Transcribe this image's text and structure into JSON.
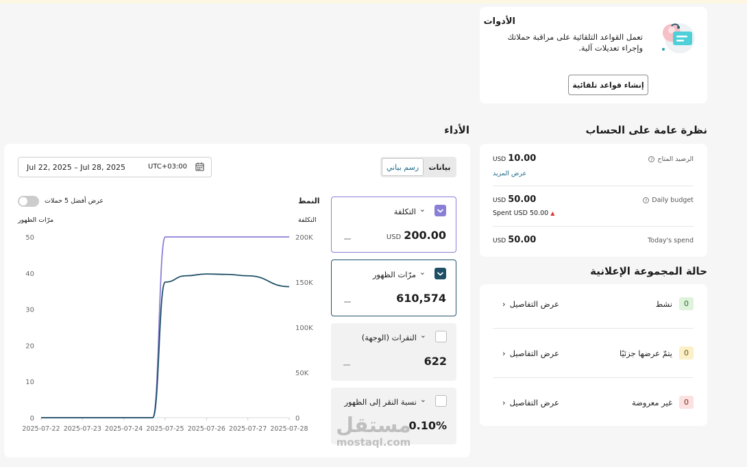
{
  "tools": {
    "title": "الأدوات",
    "description": "تعمل القواعد التلقائية على مراقبة حملاتك وإجراء تعديلات آلية.",
    "button_label": "إنشاء قواعد تلقائية"
  },
  "performance": {
    "title": "الأداء",
    "date_range": "Jul 22, 2025 – Jul 28, 2025",
    "timezone": "UTC+03:00",
    "tabs": {
      "data": "بيانات",
      "chart": "رسم بياني"
    },
    "pattern_label": "النمط",
    "top5_label": "عرض أفضل 5 حملات",
    "left_axis_title": "مرّات الظهور",
    "right_axis_title": "التكلفة",
    "metrics": [
      {
        "label": "التكلفة",
        "currency": "USD",
        "value": "200.00",
        "checked": true,
        "color": "#8a7fd6"
      },
      {
        "label": "مرّات الظهور",
        "value": "610,574",
        "checked": true,
        "color": "#1e4f66"
      },
      {
        "label": "النقرات (الوجهة)",
        "value": "622",
        "checked": false
      },
      {
        "label": "نسبة النقر إلى الظهور",
        "value": "0.10%",
        "checked": false
      }
    ]
  },
  "overview": {
    "title": "نظرة عامة على الحساب",
    "available_balance": {
      "label": "الرصيد المتاح",
      "currency": "USD",
      "value": "10.00",
      "link": "عرض المزيد"
    },
    "daily_budget": {
      "label": "Daily budget",
      "currency": "USD",
      "value": "50.00",
      "spent": "Spent USD 50.00"
    },
    "todays_spend": {
      "label": "Today's spend",
      "currency": "USD",
      "value": "50.00"
    }
  },
  "ad_group_status": {
    "title": "حالة المجموعة الإعلانية",
    "rows": [
      {
        "label": "نشط",
        "count": "0",
        "link": "عرض التفاصيل",
        "badge_bg": "#dff3dc",
        "badge_fg": "#2d6b2a"
      },
      {
        "label": "يتمّ عرضها جزئيًا",
        "count": "0",
        "link": "عرض التفاصيل",
        "badge_bg": "#fbf0c8",
        "badge_fg": "#6b5a12"
      },
      {
        "label": "غير معروضة",
        "count": "0",
        "link": "عرض التفاصيل",
        "badge_bg": "#fbe1df",
        "badge_fg": "#8a2a22"
      }
    ]
  },
  "watermark": {
    "arabic": "مستقل",
    "latin": "mostaql.com"
  },
  "chart_data": {
    "type": "line",
    "x": [
      "2025-07-22",
      "2025-07-23",
      "2025-07-24",
      "2025-07-25",
      "2025-07-26",
      "2025-07-27",
      "2025-07-28"
    ],
    "left_axis": {
      "title": "مرّات الظهور",
      "ticks": [
        "0",
        "10",
        "20",
        "30",
        "40",
        "50"
      ],
      "range": [
        0,
        50
      ]
    },
    "right_axis": {
      "title": "التكلفة",
      "ticks": [
        "0",
        "50K",
        "100K",
        "150K",
        "200K"
      ],
      "range": [
        0,
        200000
      ]
    },
    "series": [
      {
        "name": "التكلفة",
        "axis": "left",
        "color": "#8a7fd6",
        "points": [
          [
            0,
            0
          ],
          [
            1,
            0
          ],
          [
            2,
            0
          ],
          [
            2.7,
            0
          ],
          [
            3,
            50
          ],
          [
            3.5,
            50
          ],
          [
            4,
            50
          ],
          [
            5,
            50
          ],
          [
            6,
            50
          ]
        ]
      },
      {
        "name": "مرّات الظهور",
        "axis": "right",
        "color": "#1e4f66",
        "points": [
          [
            0,
            0
          ],
          [
            1,
            0
          ],
          [
            2,
            0
          ],
          [
            2.7,
            0
          ],
          [
            3,
            150000
          ],
          [
            3.5,
            157000
          ],
          [
            4,
            159000
          ],
          [
            4.5,
            158500
          ],
          [
            5,
            157000
          ],
          [
            6,
            145000
          ]
        ]
      }
    ],
    "grid": false,
    "legend": "none"
  }
}
